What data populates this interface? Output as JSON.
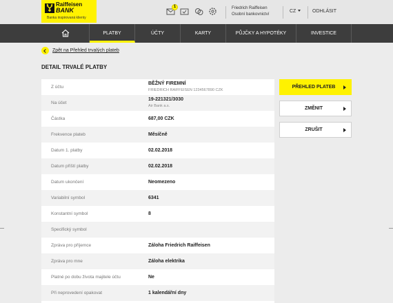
{
  "brand": {
    "name": "Raiffeisen",
    "bank": "BANK",
    "tagline": "Banka inspirovaná klienty"
  },
  "header": {
    "notification_count": "1",
    "icons": [
      "mail-icon",
      "messages-icon",
      "currency-icon",
      "settings-icon"
    ],
    "user_name": "Friedrich Raiffeisen",
    "user_role": "Osobní bankovnictví",
    "language": "CZ",
    "logout_label": "ODHLÁSIT"
  },
  "nav": {
    "items": [
      {
        "label": "PLATBY",
        "active": true
      },
      {
        "label": "ÚČTY",
        "active": false
      },
      {
        "label": "KARTY",
        "active": false
      },
      {
        "label": "PŮJČKY A HYPOTÉKY",
        "active": false
      },
      {
        "label": "INVESTICE",
        "active": false
      }
    ]
  },
  "back_link": "Zpět na Přehled trvalých plateb",
  "page_title": "DETAIL TRVALÉ PLATBY",
  "details": [
    {
      "label": "Z účtu",
      "value": "BĚŽNÝ FIREMNÍ",
      "sub": "FRIEDRICH RAIFFEISEN 1234567890 CZK"
    },
    {
      "label": "Na účet",
      "value": "19-221321/3030",
      "sub": "Air Bank a.s."
    },
    {
      "label": "Částka",
      "value": "687,00 CZK"
    },
    {
      "label": "Frekvence plateb",
      "value": "Měsíčně"
    },
    {
      "label": "Datum 1. platby",
      "value": "02.02.2018"
    },
    {
      "label": "Datum příští platby",
      "value": "02.02.2018"
    },
    {
      "label": "Datum ukončení",
      "value": "Neomezeno"
    },
    {
      "label": "Variabilní symbol",
      "value": "6341"
    },
    {
      "label": "Konstantní symbol",
      "value": "8"
    },
    {
      "label": "Specifický symbol",
      "value": ""
    },
    {
      "label": "Zpráva pro příjemce",
      "value": "Záloha Friedrich Raiffeisen"
    },
    {
      "label": "Zpráva pro mne",
      "value": "Záloha elektrika"
    },
    {
      "label": "Platné po dobu života majitele účtu",
      "value": "Ne"
    },
    {
      "label": "Při neprovedení opakovat",
      "value": "1 kalendářní dny"
    }
  ],
  "actions": {
    "overview": "PŘEHLED PLATEB",
    "change": "ZMĚNIT",
    "cancel": "ZRUŠIT"
  },
  "colors": {
    "brand_yellow": "#fff200",
    "nav_background": "#3d3d3d",
    "page_background": "#ececec"
  }
}
